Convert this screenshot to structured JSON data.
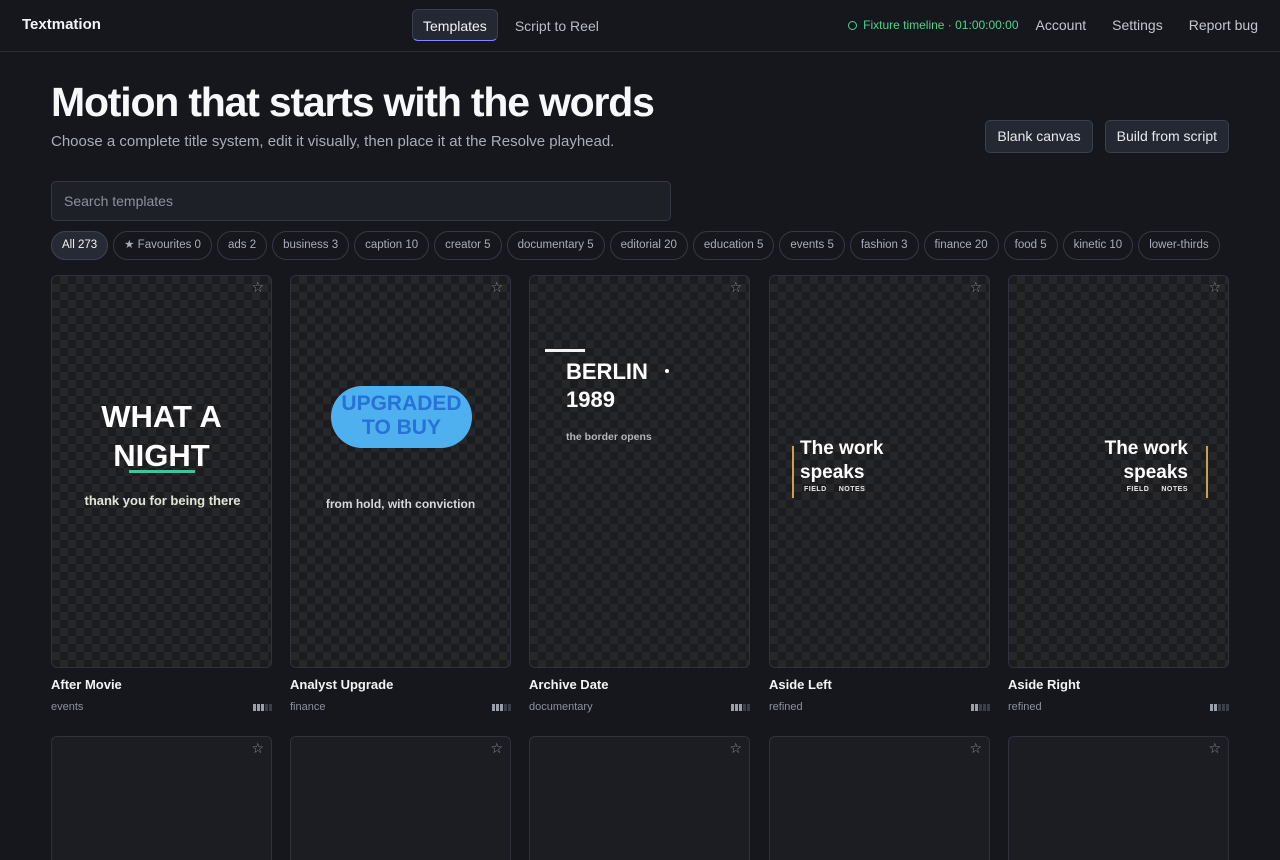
{
  "header": {
    "brand": "Textmation",
    "tabs": [
      {
        "label": "Templates",
        "active": true
      },
      {
        "label": "Script to Reel",
        "active": false
      }
    ],
    "status": "Fixture timeline · 01:00:00:00",
    "links": [
      "Account",
      "Settings",
      "Report bug"
    ]
  },
  "hero": {
    "title": "Motion that starts with the words",
    "subtitle": "Choose a complete title system, edit it visually, then place it at the Resolve playhead.",
    "actions": [
      "Blank canvas",
      "Build from script"
    ]
  },
  "search": {
    "placeholder": "Search templates",
    "value": ""
  },
  "chips": [
    "All 273",
    "★ Favourites 0",
    "ads 2",
    "business 3",
    "caption 10",
    "creator 5",
    "documentary 5",
    "editorial 20",
    "education 5",
    "events 5",
    "fashion 3",
    "finance 20",
    "food 5",
    "kinetic 10",
    "lower-thirds"
  ],
  "cards": [
    {
      "name": "After Movie",
      "category": "events",
      "level": 3,
      "preview": {
        "line1": "WHAT A",
        "line2": "NIGHT",
        "sub": "thank you for being there"
      }
    },
    {
      "name": "Analyst Upgrade",
      "category": "finance",
      "level": 3,
      "preview": {
        "line1": "UPGRADED",
        "line2": "TO BUY",
        "sub": "from hold, with conviction"
      }
    },
    {
      "name": "Archive Date",
      "category": "documentary",
      "level": 3,
      "preview": {
        "line1": "BERLIN",
        "line2": "1989",
        "sub": "the border opens"
      }
    },
    {
      "name": "Aside Left",
      "category": "refined",
      "level": 2,
      "preview": {
        "line1": "The work",
        "line2": "speaks",
        "tag1": "FIELD",
        "tag2": "NOTES"
      }
    },
    {
      "name": "Aside Right",
      "category": "refined",
      "level": 2,
      "preview": {
        "line1": "The work",
        "line2": "speaks",
        "tag1": "FIELD",
        "tag2": "NOTES"
      }
    }
  ],
  "icons": {
    "star": "star-outline-icon",
    "status": "circle-status-icon"
  },
  "colors": {
    "background": "#15171c",
    "status": "#4fd18b",
    "accent_tab": "#7b8cff",
    "underline": "#3fc39a",
    "pill": "#4fb0f0",
    "gold_bar": "#c9a24a"
  }
}
